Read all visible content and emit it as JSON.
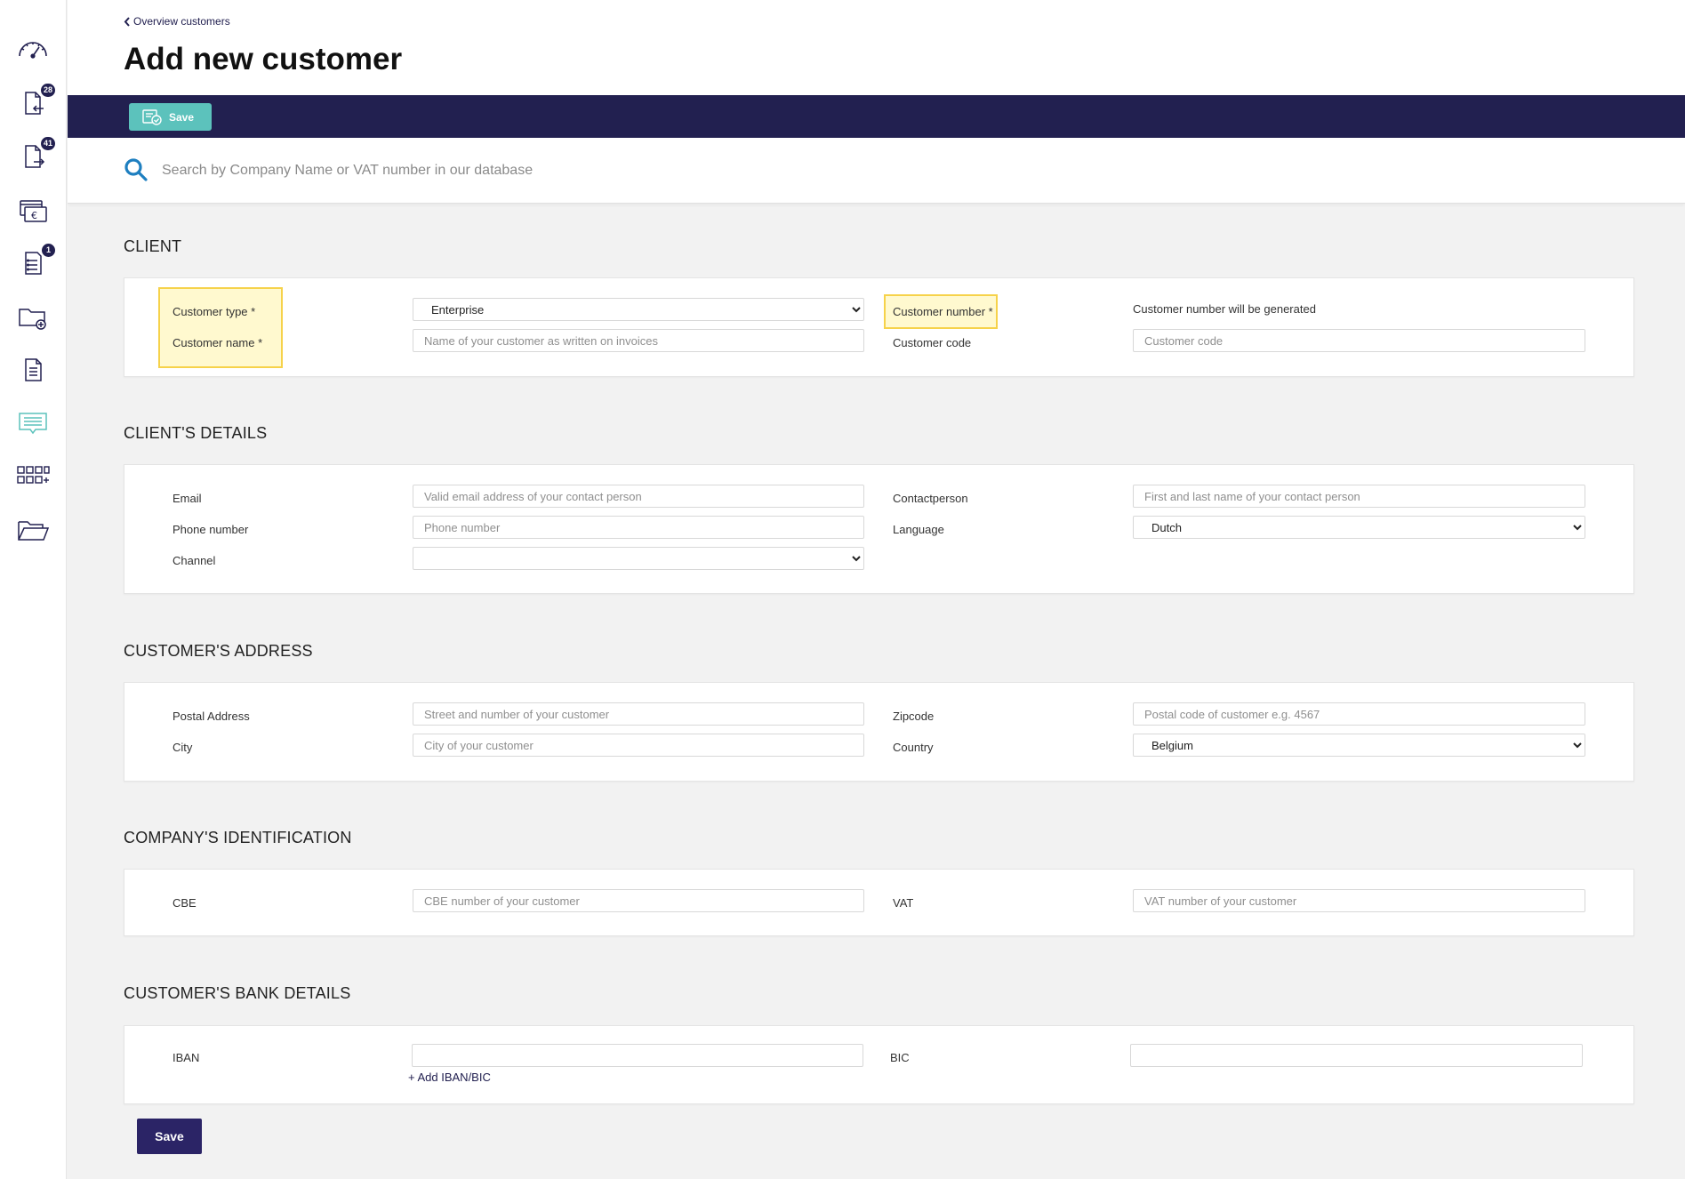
{
  "sidebar": {
    "items": [
      {
        "icon": "dashboard-gauge-icon",
        "badge": ""
      },
      {
        "icon": "incoming-documents-icon",
        "badge": "28"
      },
      {
        "icon": "outgoing-documents-icon",
        "badge": "41"
      },
      {
        "icon": "payments-euro-icon",
        "badge": ""
      },
      {
        "icon": "tasks-list-icon",
        "badge": "1"
      },
      {
        "icon": "folder-add-icon",
        "badge": ""
      },
      {
        "icon": "document-icon",
        "badge": ""
      },
      {
        "icon": "messages-icon",
        "badge": ""
      },
      {
        "icon": "apps-grid-icon",
        "badge": ""
      },
      {
        "icon": "open-folder-icon",
        "badge": ""
      }
    ]
  },
  "header": {
    "breadcrumb": "Overview customers",
    "title": "Add new customer"
  },
  "toolbar": {
    "save_label": "Save"
  },
  "search": {
    "placeholder": "Search by Company Name or VAT number in our database"
  },
  "sections": {
    "client": {
      "title": "CLIENT",
      "customer_type_label": "Customer type *",
      "customer_type_value": "Enterprise",
      "customer_name_label": "Customer name *",
      "customer_name_placeholder": "Name of your customer as written on invoices",
      "customer_number_label": "Customer number *",
      "customer_number_note": "Customer number will be generated",
      "customer_code_label": "Customer code",
      "customer_code_placeholder": "Customer code"
    },
    "details": {
      "title": "CLIENT'S DETAILS",
      "email_label": "Email",
      "email_placeholder": "Valid email address of your contact person",
      "phone_label": "Phone number",
      "phone_placeholder": "Phone number",
      "channel_label": "Channel",
      "channel_value": "",
      "contact_label": "Contactperson",
      "contact_placeholder": "First and last name of your contact person",
      "language_label": "Language",
      "language_value": "Dutch"
    },
    "address": {
      "title": "CUSTOMER'S ADDRESS",
      "postal_label": "Postal Address",
      "postal_placeholder": "Street and number of your customer",
      "city_label": "City",
      "city_placeholder": "City of your customer",
      "zipcode_label": "Zipcode",
      "zipcode_placeholder": "Postal code of customer e.g. 4567",
      "country_label": "Country",
      "country_value": "Belgium"
    },
    "identification": {
      "title": "COMPANY'S IDENTIFICATION",
      "cbe_label": "CBE",
      "cbe_placeholder": "CBE number of your customer",
      "vat_label": "VAT",
      "vat_placeholder": "VAT number of your customer"
    },
    "bank": {
      "title": "CUSTOMER'S BANK DETAILS",
      "iban_label": "IBAN",
      "iban_value": "",
      "bic_label": "BIC",
      "bic_value": "",
      "add_link": "+ Add IBAN/BIC"
    }
  },
  "footer": {
    "save_label": "Save"
  },
  "colors": {
    "navy": "#222050",
    "teal_button": "#5cc2bc",
    "footer_button": "#2b2466",
    "highlight_border": "#f6d24a",
    "highlight_fill": "#fff9cf",
    "page_bg": "#f2f2f2"
  }
}
